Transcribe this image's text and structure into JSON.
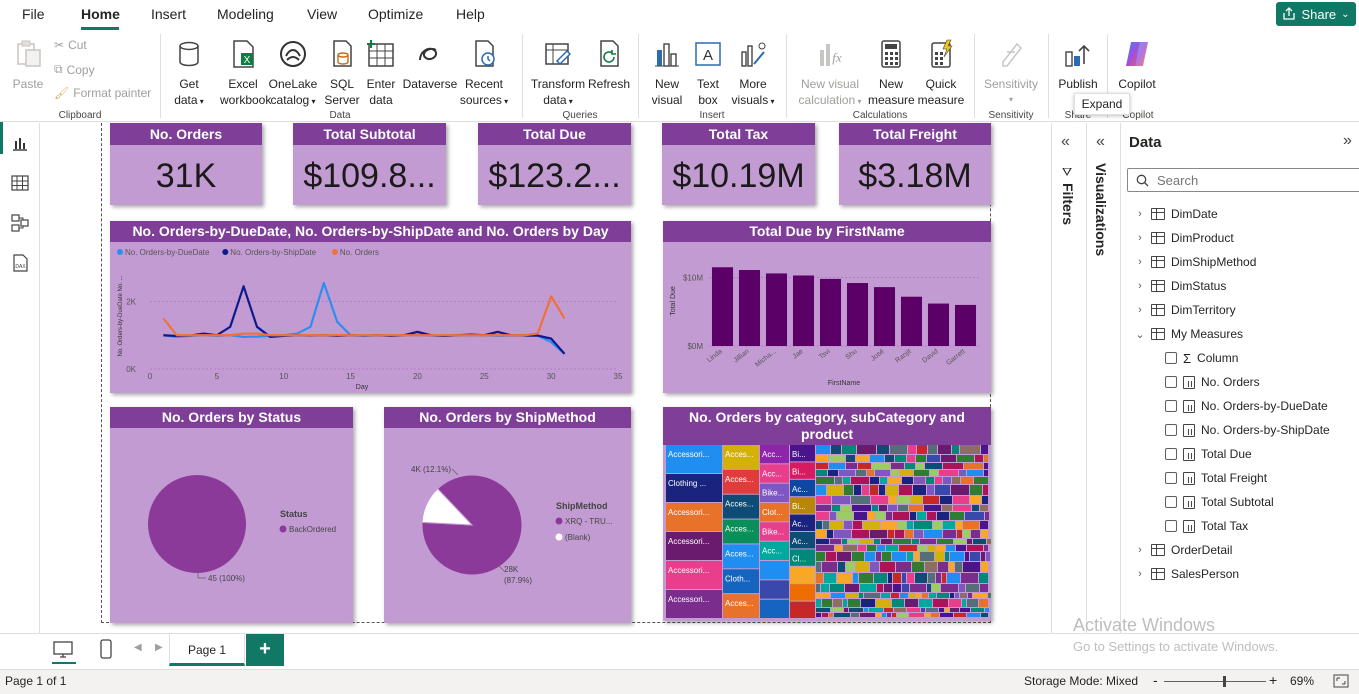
{
  "menu": {
    "tabs": [
      "File",
      "Home",
      "Insert",
      "Modeling",
      "View",
      "Optimize",
      "Help"
    ],
    "share": "Share"
  },
  "ribbon": {
    "clipboard": {
      "paste": "Paste",
      "cut": "Cut",
      "copy": "Copy",
      "format_painter": "Format painter",
      "group": "Clipboard"
    },
    "data": {
      "get_data": [
        "Get",
        "data"
      ],
      "excel": [
        "Excel",
        "workbook"
      ],
      "onelake": [
        "OneLake",
        "catalog"
      ],
      "sql": [
        "SQL",
        "Server"
      ],
      "enter": [
        "Enter",
        "data"
      ],
      "dataverse": "Dataverse",
      "recent": [
        "Recent",
        "sources"
      ],
      "group": "Data"
    },
    "queries": {
      "transform": [
        "Transform",
        "data"
      ],
      "refresh": "Refresh",
      "group": "Queries"
    },
    "insert": {
      "new_visual": [
        "New",
        "visual"
      ],
      "text_box": [
        "Text",
        "box"
      ],
      "more_visuals": [
        "More",
        "visuals"
      ],
      "group": "Insert"
    },
    "calculations": {
      "new_visual_calc": [
        "New visual",
        "calculation"
      ],
      "new_measure": [
        "New",
        "measure"
      ],
      "quick_measure": [
        "Quick",
        "measure"
      ],
      "group": "Calculations"
    },
    "sensitivity": {
      "label": "Sensitivity",
      "group": "Sensitivity"
    },
    "share": {
      "publish": "Publish",
      "group": "Share"
    },
    "copilot": {
      "label": "Copilot",
      "group": "Copilot"
    }
  },
  "tooltip": "Expand",
  "kpis": [
    {
      "title": "No. Orders",
      "value": "31K"
    },
    {
      "title": "Total Subtotal",
      "value": "$109.8..."
    },
    {
      "title": "Total Due",
      "value": "$123.2..."
    },
    {
      "title": "Total Tax",
      "value": "$10.19M"
    },
    {
      "title": "Total Freight",
      "value": "$3.18M"
    }
  ],
  "colors": {
    "header": "#7f3f98",
    "card": "#c39bd3",
    "bar": "#5b0066",
    "pie": "#8b3a99",
    "accent": "#117865"
  },
  "chart_data": [
    {
      "type": "line",
      "title": "No. Orders-by-DueDate, No. Orders-by-ShipDate and No. Orders by Day",
      "xlabel": "Day",
      "ylabel": "No. Orders-by-DueDate No. ...",
      "xlim": [
        0,
        35
      ],
      "ylim": [
        0,
        3200
      ],
      "xticks": [
        0,
        5,
        10,
        15,
        20,
        25,
        30,
        35
      ],
      "yticks": [
        {
          "v": 0,
          "label": "0K"
        },
        {
          "v": 2000,
          "label": "2K"
        }
      ],
      "x": [
        1,
        2,
        3,
        4,
        5,
        6,
        7,
        8,
        9,
        10,
        11,
        12,
        13,
        14,
        15,
        16,
        17,
        18,
        19,
        20,
        21,
        22,
        23,
        24,
        25,
        26,
        27,
        28,
        29,
        30,
        31
      ],
      "series": [
        {
          "name": "No. Orders-by-DueDate",
          "color": "#2b8ef0",
          "values": [
            1000,
            950,
            980,
            1000,
            980,
            1000,
            950,
            960,
            980,
            1000,
            1050,
            1250,
            2550,
            1400,
            1000,
            980,
            1000,
            990,
            1000,
            1000,
            990,
            980,
            1000,
            990,
            1000,
            980,
            990,
            1000,
            990,
            800,
            450
          ]
        },
        {
          "name": "No. Orders-by-ShipDate",
          "color": "#0d1a8c",
          "values": [
            1000,
            980,
            990,
            1050,
            1000,
            1250,
            2450,
            1250,
            950,
            980,
            1000,
            990,
            1000,
            980,
            1000,
            990,
            1000,
            980,
            1000,
            1100,
            1000,
            980,
            1000,
            1020,
            1000,
            1100,
            1000,
            990,
            990,
            900,
            450
          ]
        },
        {
          "name": "No. Orders",
          "color": "#f0703a",
          "values": [
            1500,
            1000,
            1000,
            1000,
            1000,
            1000,
            1050,
            1050,
            1000,
            1000,
            1000,
            1000,
            1000,
            1000,
            1000,
            1000,
            1000,
            1000,
            1000,
            1000,
            1000,
            1000,
            1000,
            1000,
            1000,
            1000,
            1000,
            1000,
            1050,
            2150,
            1500
          ]
        }
      ]
    },
    {
      "type": "bar",
      "title": "Total Due by FirstName",
      "xlabel": "FirstName",
      "ylabel": "Total Due",
      "yticks": [
        {
          "v": 0,
          "label": "$0M"
        },
        {
          "v": 10,
          "label": "$10M"
        }
      ],
      "ylim": [
        0,
        13
      ],
      "categories": [
        "Linda",
        "Jillian",
        "Micha...",
        "Jae",
        "Tsvi",
        "Shu",
        "José",
        "Ranjit",
        "David",
        "Garrett"
      ],
      "values": [
        11.5,
        11.1,
        10.6,
        10.3,
        9.8,
        9.2,
        8.6,
        7.2,
        6.2,
        6.0
      ]
    },
    {
      "type": "pie",
      "title": "No. Orders by Status",
      "legend_title": "Status",
      "slices": [
        {
          "name": "BackOrdered",
          "value": 45,
          "label": "45 (100%)",
          "color": "#8b3a99"
        }
      ]
    },
    {
      "type": "pie",
      "title": "No. Orders by ShipMethod",
      "legend_title": "ShipMethod",
      "slices": [
        {
          "name": "XRQ - TRU...",
          "value": 27.5,
          "label": "28K",
          "sublabel": "(87.9%)",
          "color": "#8b3a99"
        },
        {
          "name": "(Blank)",
          "value": 3.78,
          "label": "4K (12.1%)",
          "color": "#ffffff"
        }
      ]
    },
    {
      "type": "treemap",
      "title": "No. Orders by category, subCategory and product",
      "columns": [
        {
          "items": [
            {
              "label": "Accessori...",
              "color": "#1f8ef0"
            },
            {
              "label": "Clothing ...",
              "color": "#1a237e"
            },
            {
              "label": "Accessori...",
              "color": "#e8722a"
            },
            {
              "label": "Accessori...",
              "color": "#6a1b6e"
            },
            {
              "label": "Accessori...",
              "color": "#e93e8c"
            },
            {
              "label": "Accessori...",
              "color": "#7b2d8e"
            }
          ]
        },
        {
          "items": [
            {
              "label": "Acces...",
              "color": "#d4b106"
            },
            {
              "label": "Acces...",
              "color": "#e03c3c"
            },
            {
              "label": "Acces...",
              "color": "#0f4c75"
            },
            {
              "label": "Acces...",
              "color": "#0a8f5a"
            },
            {
              "label": "Acces...",
              "color": "#1f8ef0"
            },
            {
              "label": "Cloth...",
              "color": "#1565c0"
            },
            {
              "label": "Acces...",
              "color": "#e8722a"
            }
          ]
        },
        {
          "items": [
            {
              "label": "Acc...",
              "color": "#8e24aa"
            },
            {
              "label": "Acc...",
              "color": "#e93e8c"
            },
            {
              "label": "Bike...",
              "color": "#7e57c2"
            },
            {
              "label": "Clot...",
              "color": "#e8722a"
            },
            {
              "label": "Bike...",
              "color": "#e93e8c"
            },
            {
              "label": "Acc...",
              "color": "#00a99d"
            },
            {
              "label": "",
              "color": "#1f8ef0"
            },
            {
              "label": "",
              "color": "#3949ab"
            },
            {
              "label": "",
              "color": "#1565c0"
            }
          ]
        },
        {
          "items": [
            {
              "label": "Bi...",
              "color": "#4a148c"
            },
            {
              "label": "Bi...",
              "color": "#d81b60"
            },
            {
              "label": "Ac...",
              "color": "#0d47a1"
            },
            {
              "label": "Bi...",
              "color": "#b8860b"
            },
            {
              "label": "Ac...",
              "color": "#1a237e"
            },
            {
              "label": "Ac...",
              "color": "#0f4c75"
            },
            {
              "label": "Cl...",
              "color": "#00897b"
            },
            {
              "label": "",
              "color": "#f9a825"
            },
            {
              "label": "",
              "color": "#ef6c00"
            },
            {
              "label": "",
              "color": "#c62828"
            }
          ]
        }
      ]
    }
  ],
  "data_pane": {
    "title": "Data",
    "search_placeholder": "Search",
    "items": [
      {
        "label": "DimDate",
        "kind": "table",
        "level": 0,
        "chev": "›"
      },
      {
        "label": "DimProduct",
        "kind": "table",
        "level": 0,
        "chev": "›"
      },
      {
        "label": "DimShipMethod",
        "kind": "table",
        "level": 0,
        "chev": "›"
      },
      {
        "label": "DimStatus",
        "kind": "table",
        "level": 0,
        "chev": "›"
      },
      {
        "label": "DimTerritory",
        "kind": "table",
        "level": 0,
        "chev": "›"
      },
      {
        "label": "My Measures",
        "kind": "table",
        "level": 0,
        "chev": "⌄"
      },
      {
        "label": "Column",
        "kind": "sum",
        "level": 1
      },
      {
        "label": "No. Orders",
        "kind": "calc",
        "level": 1
      },
      {
        "label": "No. Orders-by-DueDate",
        "kind": "calc",
        "level": 1
      },
      {
        "label": "No. Orders-by-ShipDate",
        "kind": "calc",
        "level": 1
      },
      {
        "label": "Total Due",
        "kind": "calc",
        "level": 1
      },
      {
        "label": "Total Freight",
        "kind": "calc",
        "level": 1
      },
      {
        "label": "Total Subtotal",
        "kind": "calc",
        "level": 1
      },
      {
        "label": "Total Tax",
        "kind": "calc",
        "level": 1
      },
      {
        "label": "OrderDetail",
        "kind": "table",
        "level": 0,
        "chev": "›"
      },
      {
        "label": "SalesPerson",
        "kind": "table",
        "level": 0,
        "chev": "›"
      }
    ]
  },
  "panes": {
    "filters": "Filters",
    "visualizations": "Visualizations"
  },
  "pages": {
    "tab": "Page 1",
    "add": "+"
  },
  "status": {
    "page": "Page 1 of 1",
    "storage": "Storage Mode: Mixed",
    "zoom": "69%",
    "zoom_fraction": 0.58
  },
  "watermark": {
    "line1": "Activate Windows",
    "line2": "Go to Settings to activate Windows."
  }
}
